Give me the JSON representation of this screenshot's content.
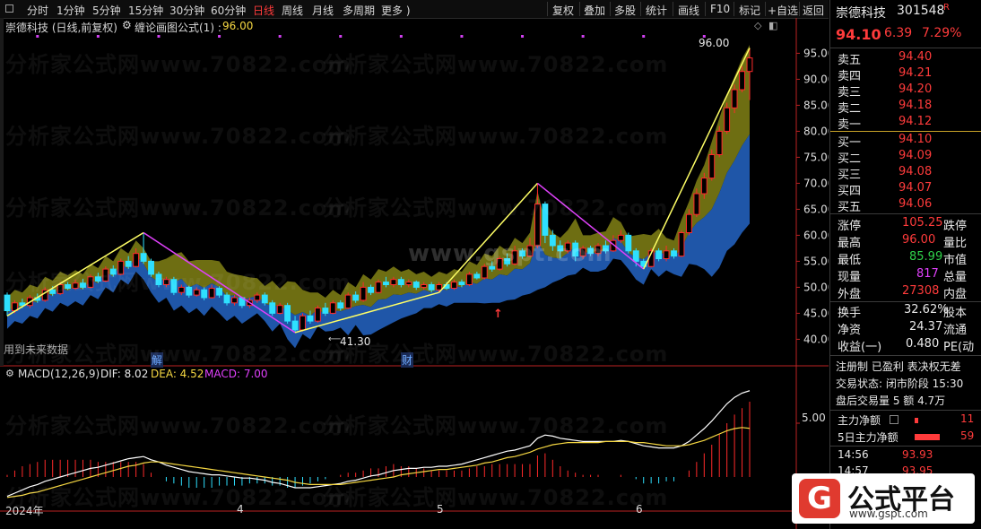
{
  "menu": {
    "periods": [
      "分时",
      "1分钟",
      "5分钟",
      "15分钟",
      "30分钟",
      "60分钟",
      "日线",
      "周线",
      "月线",
      "多周期",
      "更多 )"
    ],
    "active_period": "日线",
    "right_buttons": [
      "复权",
      "叠加",
      "多股",
      "统计",
      "画线",
      "F10",
      "标记",
      "+自选",
      "返回"
    ]
  },
  "chart_header": {
    "stock": "崇德科技 (日线,前复权)",
    "indicator": "缠论画图公式(1) : ",
    "indicator_value": "96.00"
  },
  "annotations": {
    "peak_label": "96.00",
    "low_label": "41.30",
    "future_data_note": "用到未来数据",
    "jie_marker": "解",
    "cai_marker": "财"
  },
  "price_axis": {
    "ticks": [
      "95.00",
      "90.00",
      "85.00",
      "80.00",
      "75.00",
      "70.00",
      "65.00",
      "60.00",
      "55.00",
      "50.00",
      "45.00",
      "40.00"
    ],
    "min": 38,
    "max": 98
  },
  "macd": {
    "title": "MACD(12,26,9)",
    "dif_label": "DIF: 8.02",
    "dea_label": "DEA: 4.52",
    "macd_label": "MACD: 7.00",
    "axis_tick": "5.00"
  },
  "date_axis": {
    "labels": [
      "2024年",
      "4",
      "5",
      "6"
    ]
  },
  "watermarks": {
    "main": "分析家公式网www.70822.com",
    "center": "www.gspt.com"
  },
  "colors": {
    "up": "#ff2a2a",
    "down": "#2ee0ff",
    "zigzag_up": "#ffff66",
    "zigzag_down": "#e040fb",
    "band_upper": "#7a7a14",
    "band_lower": "#1f56a8",
    "dif": "#ffffff",
    "dea": "#f5d742"
  },
  "chart_data": {
    "type": "candlestick",
    "series": [
      {
        "name": "K",
        "values": [
          [
            48.5,
            45.5,
            49.0,
            44.5
          ],
          [
            45.5,
            47.0,
            47.5,
            45.0
          ],
          [
            47.0,
            46.5,
            47.8,
            46.0
          ],
          [
            46.5,
            48.0,
            48.5,
            46.0
          ],
          [
            48.0,
            47.5,
            48.8,
            47.0
          ],
          [
            47.5,
            49.5,
            50.0,
            47.2
          ],
          [
            49.5,
            48.8,
            50.2,
            48.3
          ],
          [
            48.8,
            50.5,
            51.0,
            48.5
          ],
          [
            50.5,
            49.8,
            51.0,
            49.5
          ],
          [
            49.8,
            50.8,
            51.5,
            49.5
          ],
          [
            50.8,
            50.0,
            51.6,
            49.6
          ],
          [
            50.0,
            52.0,
            52.5,
            49.8
          ],
          [
            52.0,
            51.2,
            52.8,
            50.8
          ],
          [
            51.2,
            53.5,
            54.0,
            51.0
          ],
          [
            53.5,
            52.5,
            54.2,
            52.0
          ],
          [
            52.5,
            55.0,
            55.5,
            52.3
          ],
          [
            55.0,
            54.0,
            56.0,
            53.5
          ],
          [
            54.0,
            56.5,
            57.5,
            53.8
          ],
          [
            56.5,
            55.0,
            60.5,
            54.5
          ],
          [
            55.0,
            52.5,
            55.5,
            52.0
          ],
          [
            52.5,
            50.5,
            53.0,
            50.0
          ],
          [
            50.5,
            51.5,
            52.0,
            50.0
          ],
          [
            51.5,
            49.0,
            52.0,
            48.5
          ],
          [
            49.0,
            50.0,
            50.5,
            48.5
          ],
          [
            50.0,
            48.5,
            50.3,
            48.0
          ],
          [
            48.5,
            49.5,
            50.0,
            48.2
          ],
          [
            49.5,
            48.0,
            50.0,
            47.5
          ],
          [
            48.0,
            49.8,
            50.5,
            47.8
          ],
          [
            49.8,
            48.5,
            50.2,
            48.0
          ],
          [
            48.5,
            47.0,
            49.0,
            46.5
          ],
          [
            47.0,
            48.0,
            48.5,
            46.5
          ],
          [
            48.0,
            46.5,
            48.2,
            46.0
          ],
          [
            46.5,
            47.5,
            48.0,
            46.0
          ],
          [
            47.5,
            48.5,
            49.0,
            47.0
          ],
          [
            48.5,
            47.0,
            49.0,
            46.5
          ],
          [
            47.0,
            45.0,
            47.5,
            44.5
          ],
          [
            45.0,
            46.5,
            47.0,
            44.8
          ],
          [
            46.5,
            43.5,
            47.0,
            43.0
          ],
          [
            43.5,
            41.8,
            44.5,
            41.3
          ],
          [
            41.8,
            44.5,
            45.0,
            41.5
          ],
          [
            44.5,
            43.5,
            45.5,
            43.0
          ],
          [
            43.5,
            46.0,
            46.5,
            43.2
          ],
          [
            46.0,
            45.0,
            47.0,
            44.5
          ],
          [
            45.0,
            47.0,
            47.5,
            44.8
          ],
          [
            47.0,
            46.0,
            47.5,
            45.5
          ],
          [
            46.0,
            48.5,
            49.0,
            45.8
          ],
          [
            48.5,
            47.5,
            49.2,
            47.0
          ],
          [
            47.5,
            50.0,
            51.0,
            47.2
          ],
          [
            50.0,
            49.0,
            50.5,
            48.5
          ],
          [
            49.0,
            51.0,
            51.5,
            48.8
          ],
          [
            51.0,
            50.5,
            52.0,
            50.0
          ],
          [
            50.5,
            51.5,
            52.0,
            50.0
          ],
          [
            51.5,
            50.5,
            52.0,
            50.0
          ],
          [
            50.5,
            51.0,
            51.5,
            50.0
          ],
          [
            51.0,
            50.0,
            51.3,
            49.5
          ],
          [
            50.0,
            50.5,
            51.0,
            49.5
          ],
          [
            50.5,
            49.5,
            51.0,
            49.0
          ],
          [
            49.5,
            50.5,
            51.0,
            49.0
          ],
          [
            50.5,
            49.8,
            51.0,
            49.5
          ],
          [
            49.8,
            51.0,
            51.5,
            49.5
          ],
          [
            51.0,
            50.5,
            51.5,
            50.0
          ],
          [
            50.5,
            52.5,
            53.0,
            50.2
          ],
          [
            52.5,
            51.8,
            53.0,
            51.5
          ],
          [
            51.8,
            54.0,
            54.5,
            51.5
          ],
          [
            54.0,
            53.5,
            55.0,
            53.0
          ],
          [
            53.5,
            55.5,
            56.0,
            53.2
          ],
          [
            55.5,
            54.5,
            56.5,
            54.0
          ],
          [
            54.5,
            57.0,
            58.0,
            54.2
          ],
          [
            57.0,
            56.0,
            57.5,
            55.5
          ],
          [
            56.0,
            58.0,
            59.5,
            55.8
          ],
          [
            58.0,
            66.0,
            70.0,
            57.5
          ],
          [
            66.0,
            60.0,
            66.5,
            58.5
          ],
          [
            60.0,
            58.0,
            61.0,
            57.0
          ],
          [
            58.0,
            57.0,
            59.0,
            55.5
          ],
          [
            57.0,
            58.5,
            59.0,
            56.5
          ],
          [
            58.5,
            56.0,
            59.0,
            55.0
          ],
          [
            56.0,
            57.5,
            58.0,
            55.5
          ],
          [
            57.5,
            56.5,
            58.0,
            56.0
          ],
          [
            56.5,
            58.0,
            58.5,
            56.0
          ],
          [
            58.0,
            57.0,
            59.0,
            56.5
          ],
          [
            57.0,
            59.0,
            60.0,
            56.8
          ],
          [
            59.0,
            60.0,
            61.0,
            58.5
          ],
          [
            60.0,
            57.0,
            60.5,
            56.5
          ],
          [
            57.0,
            55.0,
            57.5,
            54.0
          ],
          [
            55.0,
            54.0,
            55.5,
            53.5
          ],
          [
            54.0,
            57.0,
            57.5,
            53.8
          ],
          [
            57.0,
            55.5,
            57.5,
            55.0
          ],
          [
            55.5,
            57.0,
            58.0,
            55.0
          ],
          [
            57.0,
            56.0,
            57.5,
            55.5
          ],
          [
            56.0,
            60.5,
            61.0,
            55.8
          ],
          [
            60.5,
            64.0,
            65.0,
            60.0
          ],
          [
            64.0,
            68.0,
            69.0,
            63.5
          ],
          [
            68.0,
            71.0,
            72.0,
            67.0
          ],
          [
            71.0,
            75.5,
            76.5,
            70.5
          ],
          [
            75.5,
            80.0,
            81.0,
            75.0
          ],
          [
            80.0,
            84.5,
            85.5,
            79.5
          ],
          [
            84.5,
            88.0,
            89.0,
            83.5
          ],
          [
            88.0,
            91.5,
            92.5,
            87.5
          ],
          [
            91.5,
            94.1,
            96.0,
            86.0
          ]
        ]
      },
      {
        "name": "DIF",
        "values": [
          -1.8,
          -1.5,
          -1.2,
          -0.9,
          -0.7,
          -0.4,
          -0.2,
          0.0,
          0.2,
          0.4,
          0.6,
          0.8,
          0.9,
          1.1,
          1.3,
          1.5,
          1.7,
          1.8,
          1.9,
          1.6,
          1.4,
          1.1,
          0.9,
          0.7,
          0.5,
          0.4,
          0.3,
          0.2,
          0.2,
          0.1,
          0.0,
          -0.1,
          -0.1,
          -0.2,
          -0.3,
          -0.5,
          -0.6,
          -0.8,
          -1.0,
          -1.0,
          -1.0,
          -0.9,
          -0.8,
          -0.7,
          -0.6,
          -0.4,
          -0.3,
          -0.1,
          0.1,
          0.2,
          0.4,
          0.6,
          0.7,
          0.8,
          0.8,
          0.9,
          0.9,
          1.0,
          1.0,
          1.1,
          1.2,
          1.4,
          1.6,
          1.8,
          2.0,
          2.2,
          2.4,
          2.5,
          2.7,
          2.9,
          3.6,
          3.9,
          3.8,
          3.6,
          3.5,
          3.4,
          3.3,
          3.3,
          3.3,
          3.3,
          3.3,
          3.4,
          3.3,
          3.1,
          2.9,
          2.8,
          2.7,
          2.7,
          2.7,
          2.9,
          3.3,
          3.9,
          4.5,
          5.2,
          6.0,
          6.8,
          7.4,
          7.8,
          8.02
        ]
      },
      {
        "name": "DEA",
        "values": [
          -1.9,
          -1.8,
          -1.7,
          -1.5,
          -1.4,
          -1.2,
          -1.0,
          -0.8,
          -0.6,
          -0.4,
          -0.2,
          0.0,
          0.2,
          0.4,
          0.6,
          0.8,
          1.0,
          1.1,
          1.3,
          1.4,
          1.4,
          1.3,
          1.2,
          1.1,
          1.0,
          0.9,
          0.8,
          0.7,
          0.6,
          0.5,
          0.4,
          0.3,
          0.2,
          0.1,
          0.0,
          -0.1,
          -0.2,
          -0.3,
          -0.5,
          -0.6,
          -0.7,
          -0.7,
          -0.7,
          -0.7,
          -0.7,
          -0.6,
          -0.5,
          -0.4,
          -0.3,
          -0.2,
          -0.1,
          0.0,
          0.2,
          0.3,
          0.4,
          0.5,
          0.6,
          0.7,
          0.7,
          0.8,
          0.9,
          1.0,
          1.1,
          1.3,
          1.4,
          1.6,
          1.8,
          1.9,
          2.1,
          2.3,
          2.6,
          2.8,
          3.0,
          3.1,
          3.2,
          3.2,
          3.2,
          3.2,
          3.2,
          3.3,
          3.3,
          3.3,
          3.3,
          3.2,
          3.2,
          3.1,
          3.0,
          2.9,
          2.9,
          2.9,
          3.0,
          3.2,
          3.4,
          3.7,
          4.0,
          4.3,
          4.5,
          4.6,
          4.52
        ]
      }
    ],
    "zigzag": [
      [
        0,
        44.5
      ],
      [
        18,
        60.5
      ],
      [
        38,
        41.3
      ],
      [
        57,
        49.0
      ],
      [
        70,
        70.0
      ],
      [
        84,
        53.5
      ],
      [
        98,
        96.0
      ]
    ],
    "ylim": [
      38,
      98
    ]
  },
  "quote": {
    "name": "崇德科技",
    "code": "301548",
    "r_mark": "R",
    "price": "94.10",
    "change": "6.39",
    "pct": "7.29%",
    "asks": [
      {
        "label": "卖五",
        "price": "94.40"
      },
      {
        "label": "卖四",
        "price": "94.21"
      },
      {
        "label": "卖三",
        "price": "94.20"
      },
      {
        "label": "卖二",
        "price": "94.18"
      },
      {
        "label": "卖一",
        "price": "94.12"
      }
    ],
    "bids": [
      {
        "label": "买一",
        "price": "94.10"
      },
      {
        "label": "买二",
        "price": "94.09"
      },
      {
        "label": "买三",
        "price": "94.08"
      },
      {
        "label": "买四",
        "price": "94.07"
      },
      {
        "label": "买五",
        "price": "94.06"
      }
    ],
    "stats": [
      {
        "label": "涨停",
        "value": "105.25",
        "label2": "跌停"
      },
      {
        "label": "最高",
        "value": "96.00",
        "label2": "量比"
      },
      {
        "label": "最低",
        "value": "85.99",
        "label2": "市值"
      },
      {
        "label": "现量",
        "value": "817",
        "label2": "总量"
      },
      {
        "label": "外盘",
        "value": "27308",
        "label2": "内盘"
      }
    ],
    "stats2": [
      {
        "label": "换手",
        "value": "32.62%",
        "label2": "股本"
      },
      {
        "label": "净资",
        "value": "24.37",
        "label2": "流通"
      },
      {
        "label": "收益(一)",
        "value": "0.480",
        "label2": "PE(动"
      }
    ],
    "tags": "注册制  已盈利  表决权无差",
    "trade_state": "交易状态: 闭市阶段 15:30",
    "after_hours": "盘后交易量 5 额 4.7万",
    "main_flow": {
      "label": "主力净额",
      "value": "11"
    },
    "main_flow_5d": {
      "label": "5日主力净额",
      "value": "59"
    },
    "ticks": [
      {
        "time": "14:56",
        "price": "93.93"
      },
      {
        "time": "14:57",
        "price": "93.95"
      }
    ]
  },
  "logo": {
    "title": "公式平台",
    "url": "www.gspt.com",
    "mark": "G"
  }
}
